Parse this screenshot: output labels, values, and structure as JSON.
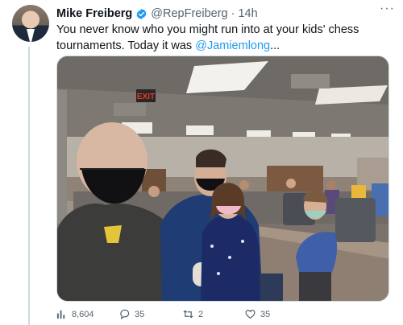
{
  "tweet": {
    "author": {
      "display_name": "Mike Freiberg",
      "handle": "@RepFreiberg",
      "separator": "·",
      "time": "14h",
      "verified": true
    },
    "text_before_mention": "You never know who you might run into at your kids' chess tournaments. Today it was ",
    "mention": "@Jamiemlong",
    "text_after_mention": "...",
    "media": {
      "exit_sign": "EXIT"
    },
    "actions": {
      "views": "8,604",
      "replies": "35",
      "retweets": "2",
      "likes": "35"
    },
    "colors": {
      "link": "#1d9bf0",
      "muted": "#536471",
      "border": "#cfd9de"
    },
    "icons": [
      "verified-badge-icon",
      "more-options-icon",
      "views-icon",
      "reply-icon",
      "retweet-icon",
      "like-icon"
    ]
  }
}
